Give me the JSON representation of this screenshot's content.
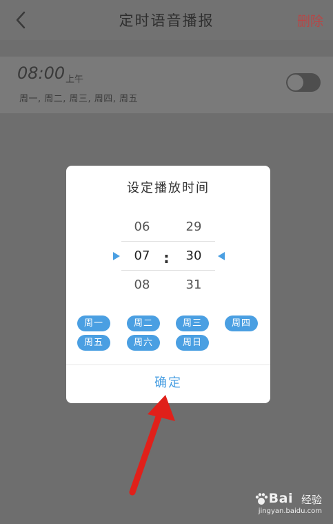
{
  "header": {
    "title": "定时语音播报",
    "delete_label": "删除",
    "back_icon": "chevron-left-icon"
  },
  "alarm": {
    "time": "08:00",
    "ampm": "上午",
    "days": "周一, 周二, 周三, 周四, 周五",
    "enabled": false
  },
  "dialog": {
    "title": "设定播放时间",
    "hours": [
      "06",
      "07",
      "08"
    ],
    "minutes": [
      "29",
      "30",
      "31"
    ],
    "selected_hour": "07",
    "selected_minute": "30",
    "separator": ":",
    "days": [
      "周一",
      "周二",
      "周三",
      "周四",
      "周五",
      "周六",
      "周日"
    ],
    "confirm_label": "确定"
  },
  "watermark": {
    "brand": "Bai",
    "brand2": "经验",
    "url": "jingyan.baidu.com"
  },
  "colors": {
    "accent": "#4a9fe2",
    "delete": "#b94545",
    "annotation_arrow": "#e0201a"
  }
}
